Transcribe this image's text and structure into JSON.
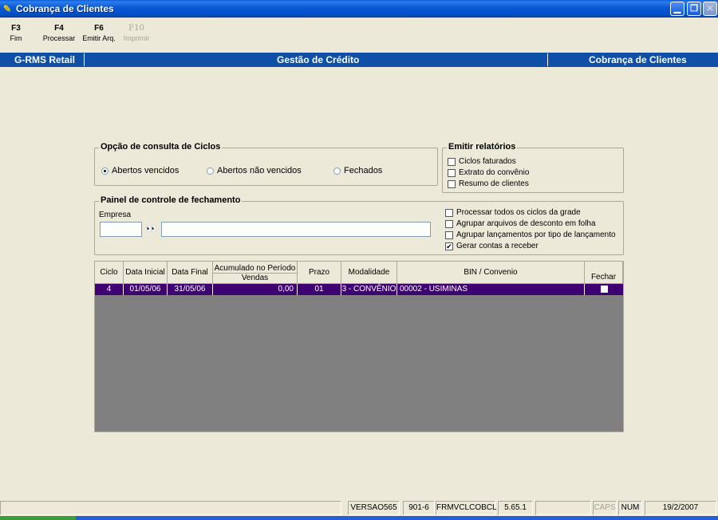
{
  "window": {
    "title": "Cobrança de Clientes",
    "app_icon": "app-icon",
    "min": "_",
    "max": "□",
    "close": "✕"
  },
  "toolbar": [
    {
      "key": "F3",
      "label": "Fim"
    },
    {
      "key": "F4",
      "label": "Processar"
    },
    {
      "key": "F6",
      "label": "Emitir Arq."
    },
    {
      "key": "F10",
      "label": "Imprimir"
    }
  ],
  "header": {
    "left": "G-RMS Retail",
    "center": "Gestão de Crédito",
    "right": "Cobrança de Clientes"
  },
  "consulta": {
    "title": "Opção de consulta de Ciclos",
    "options": [
      "Abertos vencidos",
      "Abertos não vencidos",
      "Fechados"
    ]
  },
  "relatorios": {
    "title": "Emitir relatórios",
    "items": [
      "Ciclos faturados",
      "Extrato do convênio",
      "Resumo de clientes"
    ]
  },
  "painel": {
    "title": "Painel de controle de fechamento",
    "empresa_label": "Empresa",
    "empresa_code": "",
    "empresa_name": "",
    "options": [
      {
        "label": "Processar todos os ciclos da grade",
        "checked": false
      },
      {
        "label": "Agrupar arquivos de desconto em folha",
        "checked": false
      },
      {
        "label": "Agrupar lançamentos por tipo de lançamento",
        "checked": false
      },
      {
        "label": "Gerar contas a receber",
        "checked": true
      }
    ]
  },
  "grid": {
    "headers": [
      "Ciclo",
      "Data Inicial",
      "Data Final",
      "Acumulado no Período",
      "Vendas",
      "Prazo",
      "Modalidade",
      "BIN / Convenio",
      "Fechar"
    ],
    "row": [
      "4",
      "01/05/06",
      "31/05/06",
      "0,00",
      "01",
      "3 - CONVÊNIO",
      "00002 - USIMINAS"
    ]
  },
  "status": [
    "VERSAO565",
    "901-6",
    "FRMVCLCOBCL",
    "5.65.1",
    "CAPS",
    "NUM",
    "19/2/2007"
  ],
  "colors": {
    "selection": "#3F0072",
    "header_bar": "#0F4FA8"
  }
}
